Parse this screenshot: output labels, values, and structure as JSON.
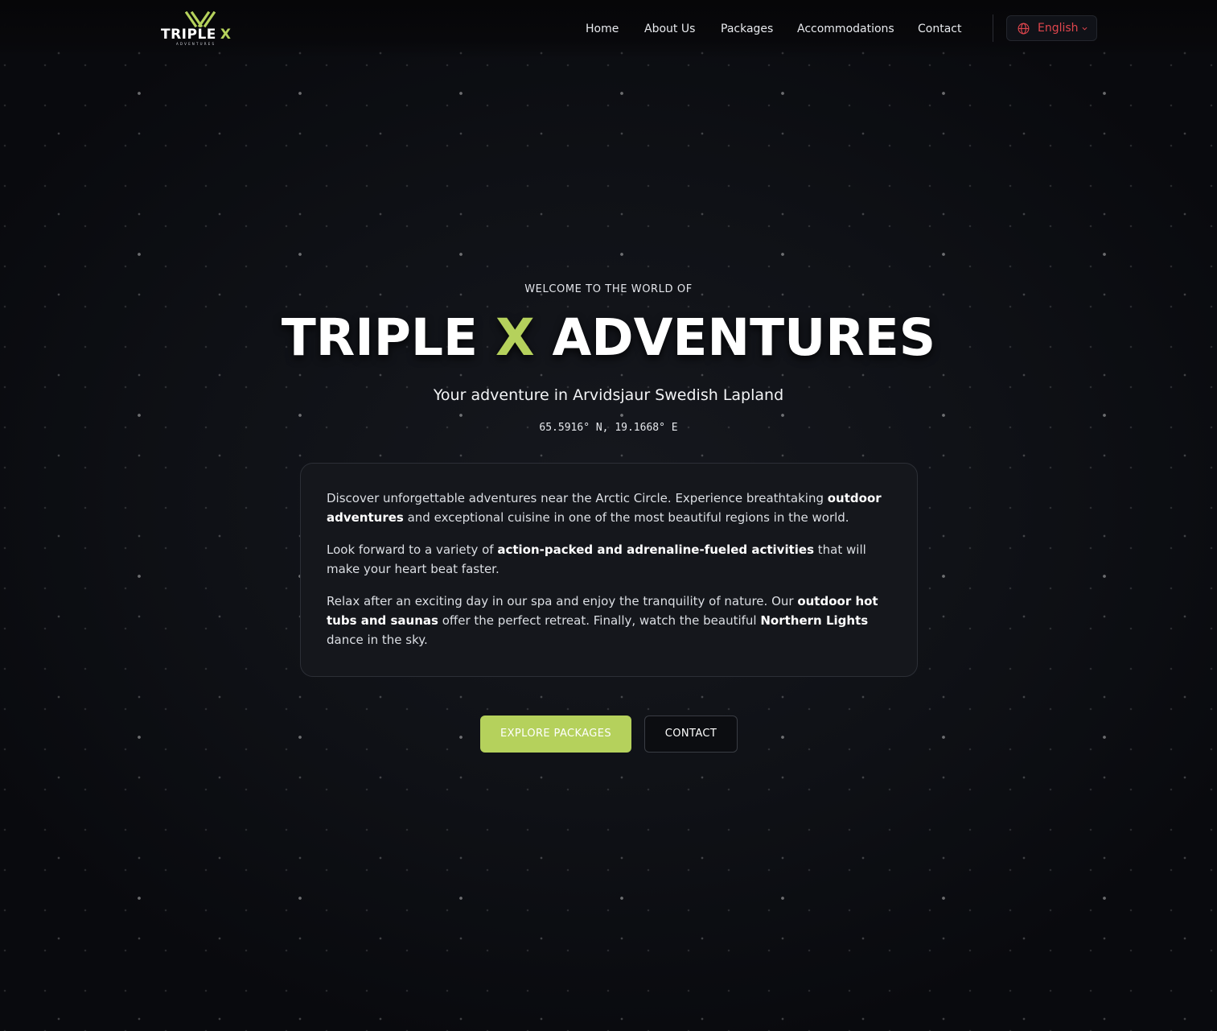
{
  "brand": {
    "logo_word": "TRIPLE",
    "logo_x": "X",
    "logo_sub": "ADVENTURES",
    "accent_color": "#b5d15c"
  },
  "nav": {
    "items": [
      {
        "label": "Home"
      },
      {
        "label": "About Us"
      },
      {
        "label": "Packages"
      },
      {
        "label": "Accommodations"
      },
      {
        "label": "Contact"
      }
    ]
  },
  "language": {
    "selected": "English",
    "icon": "globe-icon",
    "chevron_icon": "chevron-down-icon",
    "color": "#e0464d"
  },
  "hero": {
    "eyebrow": "WELCOME TO THE WORLD OF",
    "title_part1": "TRIPLE",
    "title_accent": "X",
    "title_part2": "ADVENTURES",
    "subtitle": "Your adventure in Arvidsjaur Swedish Lapland",
    "coordinates": "65.5916° N, 19.1668° E"
  },
  "intro": {
    "p1": {
      "a": "Discover unforgettable adventures near the Arctic Circle. Experience breathtaking ",
      "b": "outdoor adventures",
      "c": " and exceptional cuisine in one of the most beautiful regions in the world."
    },
    "p2": {
      "a": "Look forward to a variety of ",
      "b": "action-packed and adrenaline-fueled activities",
      "c": " that will make your heart beat faster."
    },
    "p3": {
      "a": "Relax after an exciting day in our spa and enjoy the tranquility of nature. Our ",
      "b": "outdoor hot tubs and saunas",
      "c": " offer the perfect retreat. Finally, watch the beautiful ",
      "d": "Northern Lights",
      "e": " dance in the sky."
    }
  },
  "cta": {
    "primary": "EXPLORE PACKAGES",
    "secondary": "CONTACT"
  }
}
